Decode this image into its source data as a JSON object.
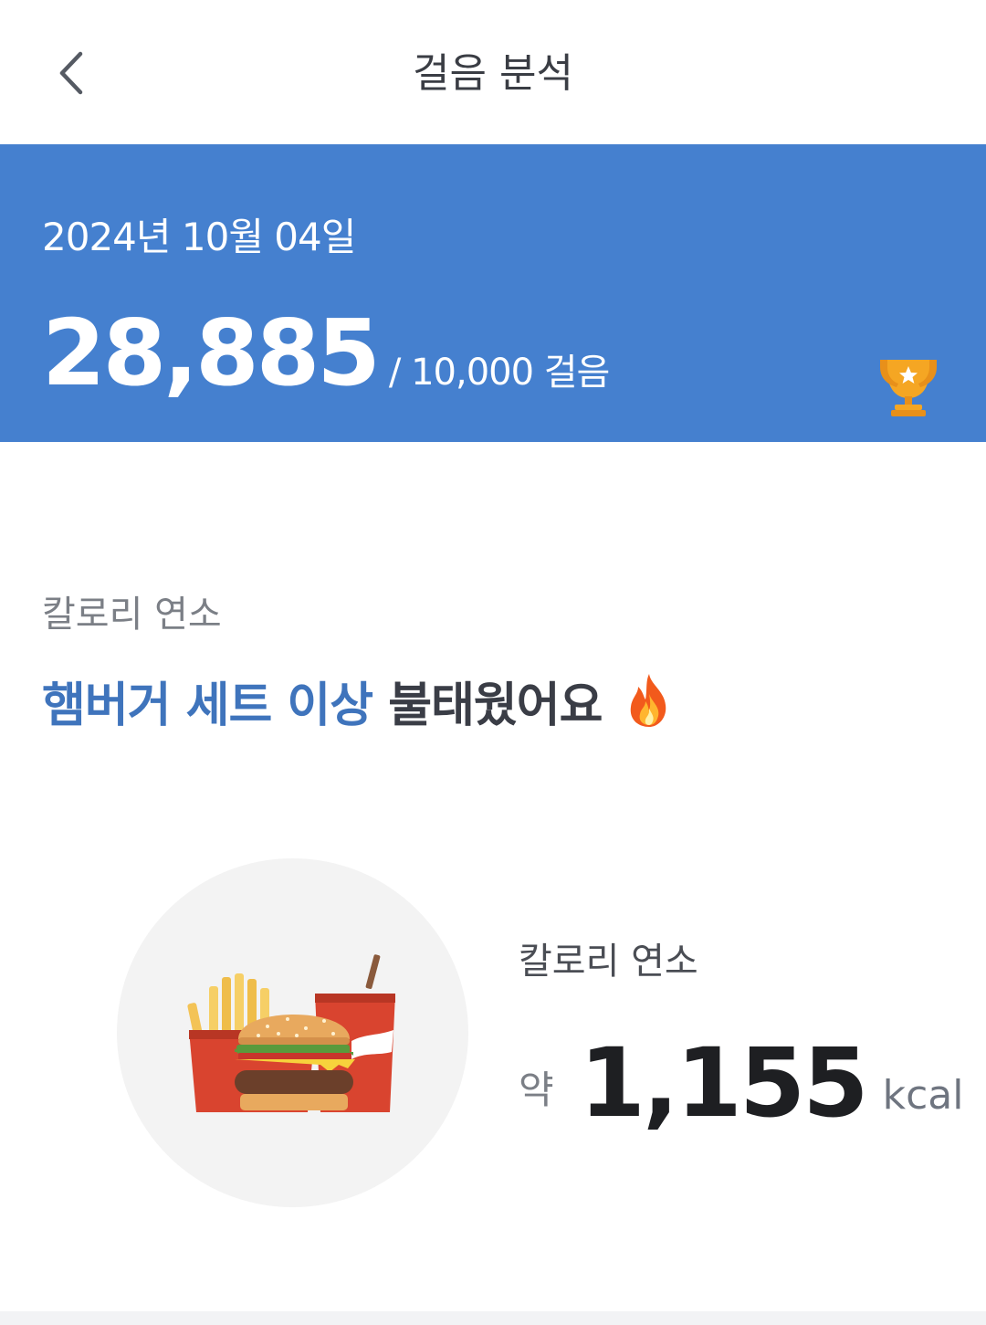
{
  "header": {
    "title": "걸음 분석",
    "back_icon": "chevron-left-icon"
  },
  "banner": {
    "date": "2024년 10월 04일",
    "steps": "28,885",
    "goal_text": "/ 10,000 걸음",
    "trophy_icon": "trophy-icon",
    "background_color": "#4580cf"
  },
  "calorie_section": {
    "label": "칼로리 연소",
    "headline_highlight": "햄버거 세트 이상",
    "headline_rest": "불태웠어요",
    "headline_emoji": "🔥",
    "illustration": "burger-set-illustration",
    "card_label": "칼로리 연소",
    "approx": "약",
    "kcal_value": "1,155",
    "kcal_unit": "kcal"
  }
}
